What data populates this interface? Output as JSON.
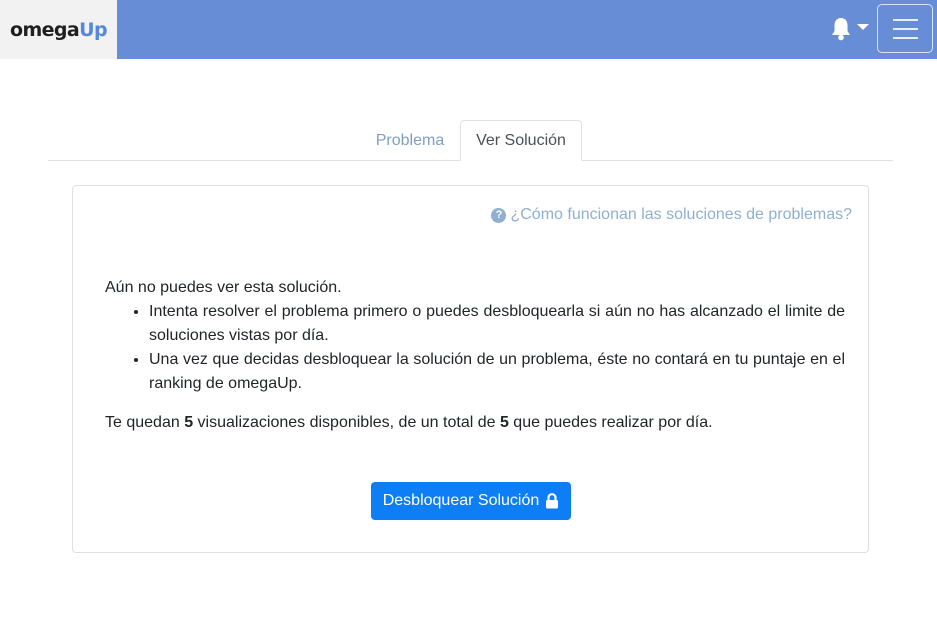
{
  "brand": {
    "part1": "omega",
    "part2": "Up"
  },
  "navbar": {
    "notifications_icon": "bell-icon",
    "dropdown_icon": "caret-down-icon",
    "menu_icon": "hamburger-icon"
  },
  "tabs": [
    {
      "label": "Problema",
      "active": false
    },
    {
      "label": "Ver Solución",
      "active": true
    }
  ],
  "card": {
    "help_link": "¿Cómo funcionan las soluciones de problemas?",
    "intro": "Aún no puedes ver esta solución.",
    "bullets": [
      "Intenta resolver el problema primero o puedes desbloquearla si aún no has alcanzado el limite de soluciones vistas por día.",
      "Una vez que decidas desbloquear la solución de un problema, éste no contará en tu puntaje en el ranking de omegaUp."
    ],
    "counts": {
      "prefix": "Te quedan ",
      "available": "5",
      "middle": " visualizaciones disponibles, de un total de ",
      "total": "5",
      "suffix": " que puedes realizar por día."
    },
    "unlock_button": "Desbloquear Solución"
  },
  "colors": {
    "navbar": "#678dd7",
    "brand_bg": "#f2f2f2",
    "brand_accent": "#5588dd",
    "button": "#0d7ef5",
    "link": "#8fb0d0"
  }
}
